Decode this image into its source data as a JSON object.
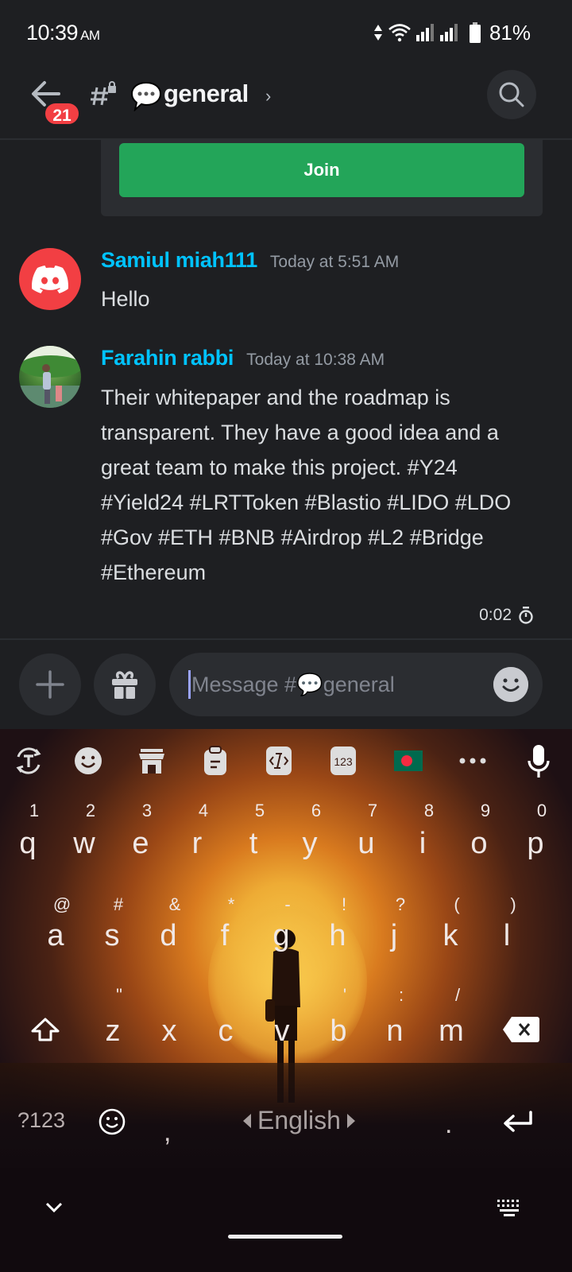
{
  "status_bar": {
    "time": "10:39",
    "ampm": "AM",
    "battery_percent": "81%",
    "icons": [
      "data-arrows-icon",
      "wifi-icon",
      "signal-icon",
      "signal-icon",
      "battery-icon"
    ]
  },
  "header": {
    "unread_badge": "21",
    "channel_emoji": "speech-bubble-icon",
    "channel_name": "general",
    "chevron": "›",
    "search_icon": "search-icon"
  },
  "embed": {
    "join_label": "Join"
  },
  "messages": [
    {
      "username": "Samiul miah111",
      "timestamp": "Today at 5:51 AM",
      "body": "Hello",
      "avatar": "discord-default-avatar"
    },
    {
      "username": "Farahin rabbi",
      "timestamp": "Today at 10:38 AM",
      "body": "Their whitepaper and the roadmap is transparent. They have a good idea and a great team to make this project. #Y24 #Yield24 #LRTToken #Blastio #LIDO #LDO #Gov #ETH #BNB #Airdrop #L2 #Bridge #Ethereum",
      "avatar": "user-photo-avatar"
    }
  ],
  "slowmode_timer": "0:02",
  "composer": {
    "placeholder": "Message #💬general",
    "value": ""
  },
  "keyboard": {
    "toolbar": [
      "translate-icon",
      "sticker-icon",
      "store-icon",
      "clipboard-icon",
      "text-edit-icon",
      "numpad-icon",
      "bangladesh-flag-icon",
      "more-icon",
      "mic-icon"
    ],
    "row1": {
      "keys": [
        "q",
        "w",
        "e",
        "r",
        "t",
        "y",
        "u",
        "i",
        "o",
        "p"
      ],
      "hints": [
        "1",
        "2",
        "3",
        "4",
        "5",
        "6",
        "7",
        "8",
        "9",
        "0"
      ]
    },
    "row2": {
      "keys": [
        "a",
        "s",
        "d",
        "f",
        "g",
        "h",
        "j",
        "k",
        "l"
      ],
      "hints": [
        "@",
        "#",
        "&",
        "*",
        "-",
        "!",
        "?",
        "(",
        ")"
      ]
    },
    "row3": {
      "keys": [
        "z",
        "x",
        "c",
        "v",
        "b",
        "n",
        "m"
      ],
      "hints": [
        "\"",
        "",
        "",
        "",
        "'",
        ":",
        "/"
      ]
    },
    "symbols_key": "?123",
    "comma_key": ",",
    "space_label": "English",
    "period_key": ".",
    "nav": {
      "hide": "chevron-down-icon",
      "switch": "keyboard-icon"
    }
  }
}
